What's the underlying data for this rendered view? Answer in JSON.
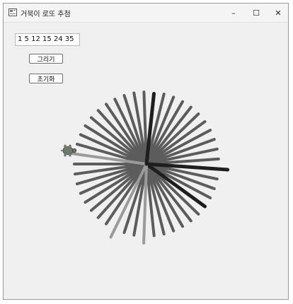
{
  "window": {
    "title": "거북이 로또 추첨",
    "icon": "app-icon",
    "controls": {
      "minimize": "–",
      "maximize": "☐",
      "close": "✕"
    }
  },
  "form": {
    "numbers_value": "1 5 12 15 24 35",
    "draw_button": "그리기",
    "reset_button": "초기화"
  },
  "drawing": {
    "ray_count": 45,
    "highlighted_numbers": [
      1,
      5,
      12,
      15,
      24,
      35
    ],
    "colors": {
      "ray": "#5c5c5c",
      "highlight_dark": "#1e1e1e",
      "highlight_light": "#9a9a9a",
      "turtle": "#6f7a6f"
    },
    "turtle_icon": "turtle-icon"
  }
}
